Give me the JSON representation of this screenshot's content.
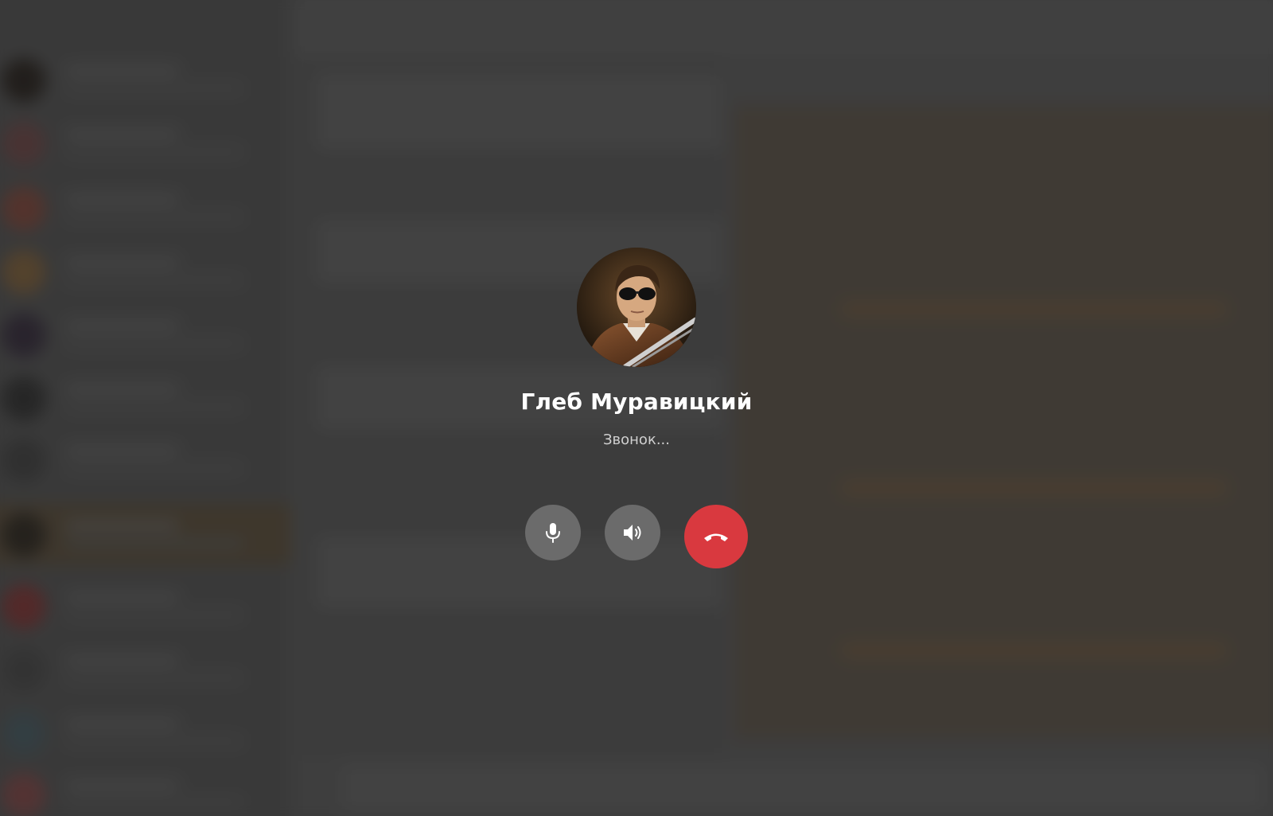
{
  "call": {
    "caller_name": "Глеб Муравицкий",
    "status": "Звонок..."
  },
  "controls": {
    "mic": {
      "icon": "microphone-icon"
    },
    "speaker": {
      "icon": "speaker-icon"
    },
    "hangup": {
      "icon": "phone-hangup-icon",
      "color": "#d9393f"
    }
  },
  "colors": {
    "overlay_button": "#6b6b6b",
    "hangup_button": "#d9393f",
    "name_text": "#ffffff",
    "status_text": "#d0d0d0"
  }
}
